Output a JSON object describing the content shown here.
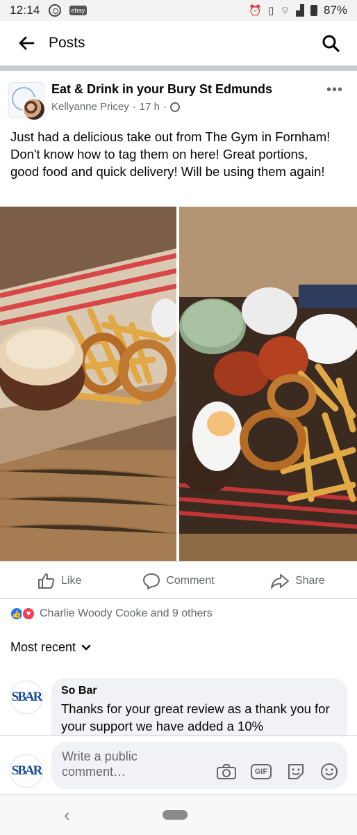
{
  "status_bar": {
    "time": "12:14",
    "app_badge": "ebay",
    "battery": "87%"
  },
  "header": {
    "title": "Posts",
    "back_icon": "back-arrow-icon",
    "search_icon": "search-icon"
  },
  "post": {
    "group_name": "Eat & Drink in your Bury St Edmunds",
    "author": "Kellyanne Pricey",
    "time": "17 h",
    "privacy_icon": "globe-icon",
    "body": "Just had a delicious take out from The Gym in Fornham! Don't know how to tag them on here! Great portions, good food and quick delivery! Will be using them again!",
    "photos": [
      "burger-and-chips-in-takeaway-box",
      "mixed-grill-with-onion-rings-and-chips"
    ]
  },
  "actions": {
    "like": "Like",
    "comment": "Comment",
    "share": "Share"
  },
  "reactions": {
    "summary": "Charlie Woody Cooke and 9 others",
    "types": [
      "like",
      "love"
    ]
  },
  "comments": {
    "sort_label": "Most recent",
    "items": [
      {
        "author": "So Bar",
        "avatar_text": "SBAR",
        "text": "Thanks for your great review as a thank you for your support we have added a 10%"
      }
    ]
  },
  "composer": {
    "avatar_text": "SBAR",
    "placeholder": "Write a public comment…",
    "icons": [
      "camera-icon",
      "gif-icon",
      "sticker-icon",
      "emoji-icon"
    ],
    "gif_label": "GIF"
  },
  "colors": {
    "accent": "#1877f2",
    "love": "#f33e58",
    "secondary_text": "#65676b",
    "divider": "#ced0d4"
  }
}
